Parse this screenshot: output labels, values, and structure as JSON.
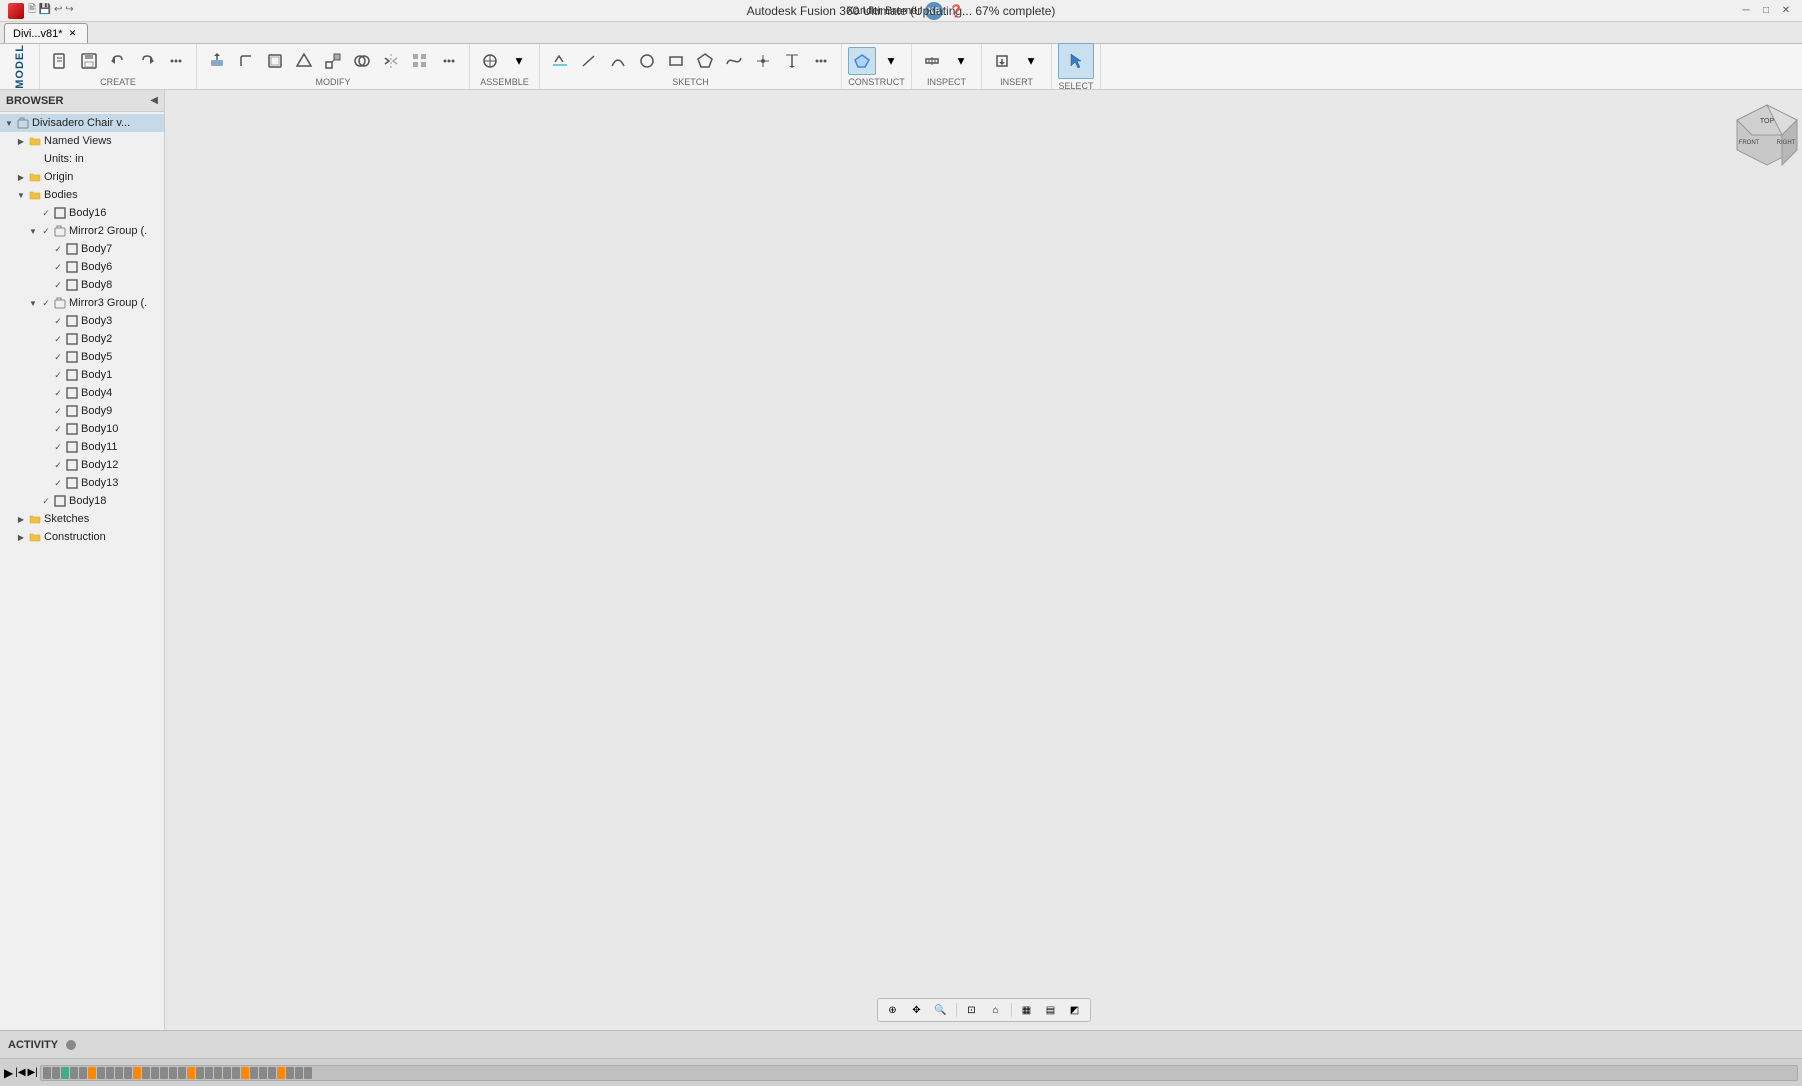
{
  "titleBar": {
    "title": "Autodesk Fusion 360 Ultimate  (Updating... 67% complete)",
    "minBtn": "─",
    "maxBtn": "□",
    "closeBtn": "✕"
  },
  "tabs": [
    {
      "label": "Divi...v81*",
      "active": true
    }
  ],
  "toolbar": {
    "modelLabel": "MODEL",
    "sections": [
      {
        "name": "CREATE",
        "buttons": [
          "new",
          "save",
          "undo",
          "redo",
          "export",
          "more"
        ]
      },
      {
        "name": "MODIFY",
        "buttons": [
          "press-pull",
          "fillet",
          "shell",
          "draft",
          "scale",
          "combine",
          "mirror",
          "pattern",
          "more"
        ]
      },
      {
        "name": "ASSEMBLE",
        "buttons": [
          "joint",
          "more"
        ]
      },
      {
        "name": "SKETCH",
        "buttons": [
          "sketch",
          "line",
          "arc",
          "circle",
          "rectangle",
          "polygon",
          "spline",
          "point",
          "project",
          "more"
        ]
      },
      {
        "name": "CONSTRUCT",
        "buttons": [
          "plane",
          "axis",
          "point",
          "more"
        ]
      },
      {
        "name": "INSPECT",
        "buttons": [
          "measure",
          "more"
        ]
      },
      {
        "name": "INSERT",
        "buttons": [
          "insert",
          "more"
        ]
      },
      {
        "name": "SELECT",
        "buttons": [
          "select"
        ]
      }
    ]
  },
  "browser": {
    "title": "BROWSER",
    "collapseBtn": "◀",
    "tree": [
      {
        "id": "root",
        "label": "Divisadero Chair v...",
        "level": 0,
        "expanded": true,
        "hasArrow": true,
        "type": "component",
        "selected": true
      },
      {
        "id": "named-views",
        "label": "Named Views",
        "level": 1,
        "expanded": false,
        "hasArrow": true,
        "type": "folder"
      },
      {
        "id": "units",
        "label": "Units: in",
        "level": 1,
        "expanded": false,
        "hasArrow": false,
        "type": "info"
      },
      {
        "id": "origin",
        "label": "Origin",
        "level": 1,
        "expanded": false,
        "hasArrow": true,
        "type": "folder"
      },
      {
        "id": "bodies",
        "label": "Bodies",
        "level": 1,
        "expanded": true,
        "hasArrow": true,
        "type": "folder"
      },
      {
        "id": "body16",
        "label": "Body16",
        "level": 2,
        "expanded": false,
        "hasArrow": false,
        "type": "body",
        "eye": true
      },
      {
        "id": "mirror2",
        "label": "Mirror2 Group (.",
        "level": 2,
        "expanded": true,
        "hasArrow": true,
        "type": "group",
        "eye": true
      },
      {
        "id": "body7",
        "label": "Body7",
        "level": 3,
        "expanded": false,
        "hasArrow": false,
        "type": "body",
        "eye": true
      },
      {
        "id": "body6",
        "label": "Body6",
        "level": 3,
        "expanded": false,
        "hasArrow": false,
        "type": "body",
        "eye": true
      },
      {
        "id": "body8",
        "label": "Body8",
        "level": 3,
        "expanded": false,
        "hasArrow": false,
        "type": "body",
        "eye": true
      },
      {
        "id": "mirror3",
        "label": "Mirror3 Group (.",
        "level": 2,
        "expanded": true,
        "hasArrow": true,
        "type": "group",
        "eye": true
      },
      {
        "id": "body3",
        "label": "Body3",
        "level": 3,
        "expanded": false,
        "hasArrow": false,
        "type": "body",
        "eye": true
      },
      {
        "id": "body2",
        "label": "Body2",
        "level": 3,
        "expanded": false,
        "hasArrow": false,
        "type": "body",
        "eye": true
      },
      {
        "id": "body5",
        "label": "Body5",
        "level": 3,
        "expanded": false,
        "hasArrow": false,
        "type": "body",
        "eye": true
      },
      {
        "id": "body1",
        "label": "Body1",
        "level": 3,
        "expanded": false,
        "hasArrow": false,
        "type": "body",
        "eye": true
      },
      {
        "id": "body4",
        "label": "Body4",
        "level": 3,
        "expanded": false,
        "hasArrow": false,
        "type": "body",
        "eye": true
      },
      {
        "id": "body9",
        "label": "Body9",
        "level": 3,
        "expanded": false,
        "hasArrow": false,
        "type": "body",
        "eye": true
      },
      {
        "id": "body10",
        "label": "Body10",
        "level": 3,
        "expanded": false,
        "hasArrow": false,
        "type": "body",
        "eye": true
      },
      {
        "id": "body11",
        "label": "Body11",
        "level": 3,
        "expanded": false,
        "hasArrow": false,
        "type": "body",
        "eye": true
      },
      {
        "id": "body12",
        "label": "Body12",
        "level": 3,
        "expanded": false,
        "hasArrow": false,
        "type": "body",
        "eye": true
      },
      {
        "id": "body13",
        "label": "Body13",
        "level": 3,
        "expanded": false,
        "hasArrow": false,
        "type": "body",
        "eye": true
      },
      {
        "id": "body18",
        "label": "Body18",
        "level": 2,
        "expanded": false,
        "hasArrow": false,
        "type": "body",
        "eye": true
      },
      {
        "id": "sketches",
        "label": "Sketches",
        "level": 1,
        "expanded": false,
        "hasArrow": true,
        "type": "folder"
      },
      {
        "id": "construction",
        "label": "Construction",
        "level": 1,
        "expanded": false,
        "hasArrow": true,
        "type": "folder"
      }
    ]
  },
  "viewport": {
    "bgColor": "#e6e6e6",
    "gridColor": "#cccccc"
  },
  "navControls": {
    "buttons": [
      "⊕",
      "⊖",
      "↺",
      "⊡",
      "⊙",
      "▦",
      "▤",
      "◩"
    ]
  },
  "statusBar": {
    "activity": "ACTIVITY",
    "updateText": "Updating... 67% complete"
  },
  "user": {
    "name": "Xander Bremer",
    "initials": "XB"
  },
  "viewcube": {
    "topLabel": "TOP",
    "frontLabel": "FRONT",
    "rightLabel": "RIGHT"
  }
}
